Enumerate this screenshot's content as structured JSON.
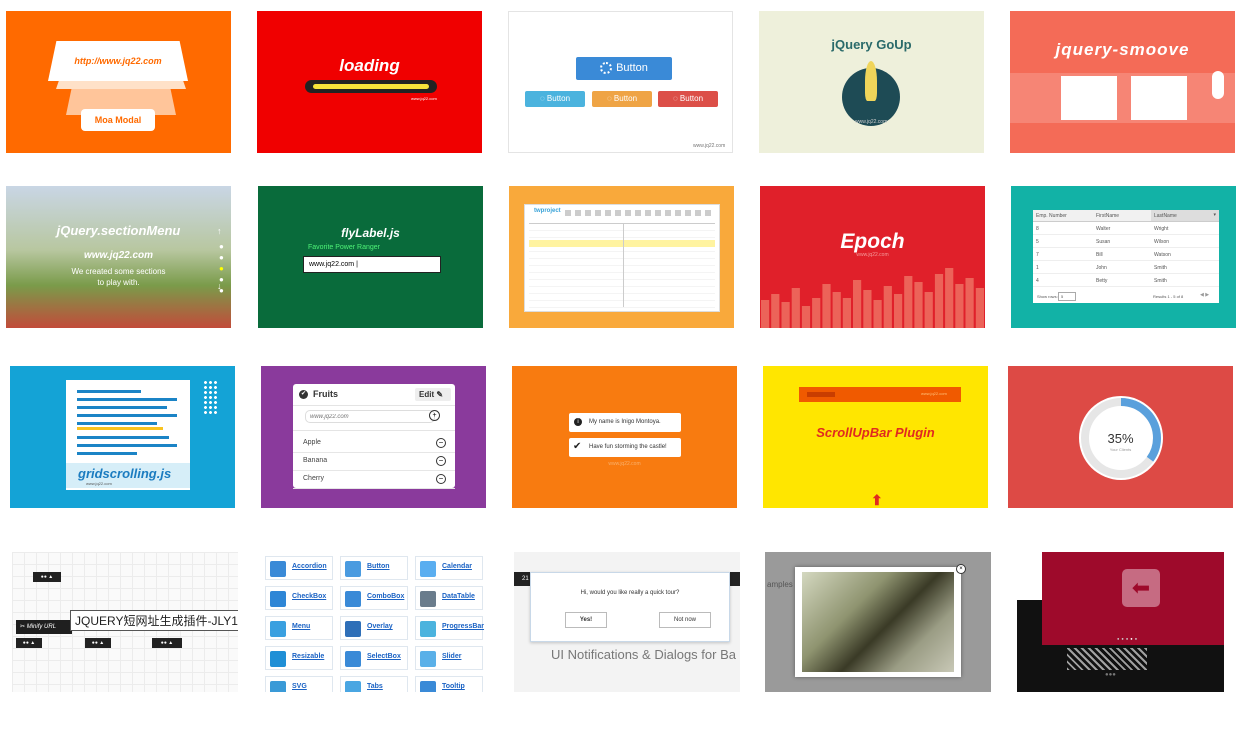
{
  "tiles": {
    "moa_modal": {
      "url": "http://www.jq22.com",
      "button": "Moa Modal"
    },
    "loading": {
      "title": "loading",
      "site": "www.jq22.com"
    },
    "ladda_buttons": {
      "main": "Button",
      "small": [
        "Button",
        "Button",
        "Button"
      ],
      "site": "www.jq22.com"
    },
    "goup": {
      "title": "jQuery GoUp",
      "site": "www.jq22.com"
    },
    "smoove": {
      "title": "jquery-smoove"
    },
    "section_menu": {
      "title": "jQuery.sectionMenu",
      "site": "www.jq22.com",
      "tagline_1": "We created some sections",
      "tagline_2": "to play with."
    },
    "flylabel": {
      "title": "flyLabel.js",
      "label": "Favorite Power Ranger",
      "value": "www.jq22.com"
    },
    "gantt": {
      "brand": "twproject"
    },
    "epoch": {
      "title": "Epoch",
      "site": "www.jq22.com",
      "bars": [
        28,
        34,
        26,
        40,
        22,
        30,
        44,
        36,
        30,
        48,
        38,
        28,
        42,
        34,
        52,
        46,
        36,
        54,
        60,
        44,
        50,
        40
      ]
    },
    "table": {
      "headers": [
        "Emp. Number",
        "FirstName",
        "LastName"
      ],
      "rows": [
        [
          "8",
          "Walter",
          "Wright"
        ],
        [
          "5",
          "Susan",
          "Wilson"
        ],
        [
          "7",
          "Bill",
          "Watson"
        ],
        [
          "1",
          "John",
          "Smith"
        ],
        [
          "4",
          "Betty",
          "Smith"
        ]
      ],
      "show_rows_label": "Show rows:",
      "show_rows_value": "5",
      "results": "Results 1 - 5 of 8"
    },
    "gridscrolling": {
      "title": "gridscrolling.js",
      "site": "www.jq22.com"
    },
    "fruits": {
      "title": "Fruits",
      "edit": "Edit",
      "placeholder": "www.jq22.com",
      "items": [
        "Apple",
        "Banana",
        "Cherry"
      ]
    },
    "notify": {
      "line_1": "My name is Inigo Montoya.",
      "line_2": "Have fun storming the castle!",
      "site": "www.jq22.com"
    },
    "scrollupbar": {
      "title": "ScrollUpBar Plugin",
      "site": "www.jq22.com"
    },
    "donut": {
      "percent": 35,
      "label": "35%",
      "sub": "Your Clients"
    },
    "minify": {
      "node_label": "Minify URL",
      "tooltip": "JQUERY短网址生成插件-JLY1"
    },
    "widgets": {
      "items": [
        "Accordion",
        "Button",
        "Calendar",
        "CheckBox",
        "ComboBox",
        "DataTable",
        "Menu",
        "Overlay",
        "ProgressBar",
        "Resizable",
        "SelectBox",
        "Slider",
        "SVG",
        "Tabs",
        "Tooltip"
      ]
    },
    "tour": {
      "header_num": "21",
      "question": "Hi, would you like really a quick tour?",
      "yes": "Yes!",
      "no": "Not now",
      "caption": "UI Notifications & Dialogs for Ba"
    },
    "lightbox": {
      "bg_text": "amples"
    },
    "slider": {
      "dots": 5,
      "active_dot": 4
    }
  },
  "colors": {
    "orange": "#ff6a00",
    "red": "#f00000",
    "teal": "#12b2a6",
    "purple": "#8a3a9c",
    "yellow": "#ffe600"
  }
}
